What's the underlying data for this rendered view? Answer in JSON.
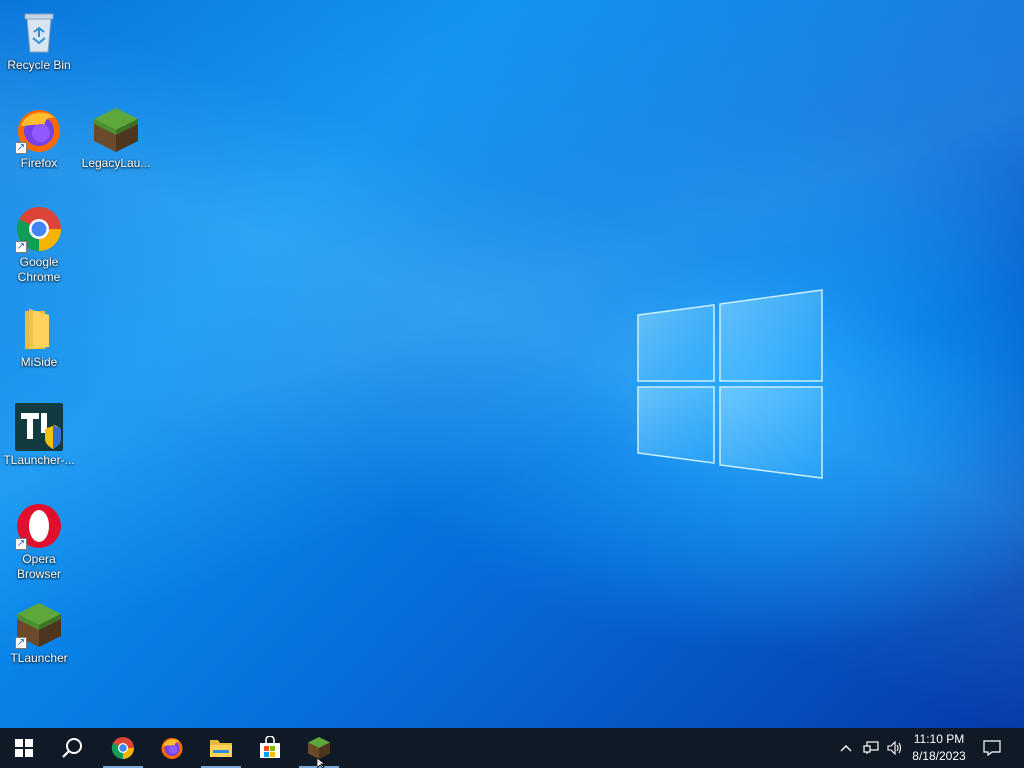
{
  "desktop": {
    "icons": [
      {
        "label": "Recycle Bin",
        "icon": "recycle-bin-icon"
      },
      {
        "label": "Firefox",
        "icon": "firefox-icon"
      },
      {
        "label": "LegacyLau...",
        "icon": "minecraft-grass-block-icon"
      },
      {
        "label": "Google Chrome",
        "icon": "chrome-icon"
      },
      {
        "label": "MiSide",
        "icon": "folder-icon"
      },
      {
        "label": "TLauncher-...",
        "icon": "tlauncher-installer-icon"
      },
      {
        "label": "Opera Browser",
        "icon": "opera-icon"
      },
      {
        "label": "TLauncher",
        "icon": "minecraft-grass-block-icon"
      }
    ]
  },
  "taskbar": {
    "buttons": [
      {
        "name": "start",
        "icon": "windows-start-icon"
      },
      {
        "name": "search",
        "icon": "search-icon"
      },
      {
        "name": "chrome",
        "icon": "chrome-icon",
        "active": true
      },
      {
        "name": "firefox",
        "icon": "firefox-icon",
        "active": false
      },
      {
        "name": "file-explorer",
        "icon": "folder-icon",
        "active": true
      },
      {
        "name": "microsoft-store",
        "icon": "store-icon",
        "active": false
      },
      {
        "name": "tlauncher",
        "icon": "minecraft-grass-block-icon",
        "active": true
      }
    ],
    "tray": {
      "icons": [
        "chevron-up-icon",
        "network-icon",
        "speaker-icon"
      ],
      "time": "11:10 PM",
      "date": "8/18/2023",
      "notification_icon": "notification-icon"
    }
  },
  "colors": {
    "taskbar": "#101a26",
    "wallpaper_blue": "#0a7ae6"
  }
}
